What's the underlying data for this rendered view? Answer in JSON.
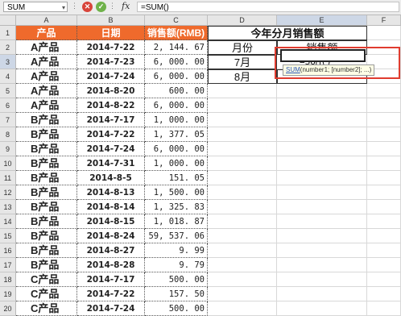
{
  "formula_bar": {
    "name_box": "SUM",
    "formula": "=SUM()",
    "fx_label": "fx"
  },
  "columns": [
    "A",
    "B",
    "C",
    "D",
    "E",
    "F"
  ],
  "rows": [
    "1",
    "2",
    "3",
    "4",
    "5",
    "6",
    "7",
    "8",
    "9",
    "10",
    "11",
    "12",
    "13",
    "14",
    "15",
    "16",
    "17",
    "18",
    "19",
    "20"
  ],
  "table": {
    "headers": [
      "产品",
      "日期",
      "销售额(RMB)"
    ],
    "rows": [
      [
        "A产品",
        "2014-7-22",
        "2, 144. 67"
      ],
      [
        "A产品",
        "2014-7-23",
        "6, 000. 00"
      ],
      [
        "A产品",
        "2014-7-24",
        "6, 000. 00"
      ],
      [
        "A产品",
        "2014-8-20",
        "600. 00"
      ],
      [
        "A产品",
        "2014-8-22",
        "6, 000. 00"
      ],
      [
        "B产品",
        "2014-7-17",
        "1, 000. 00"
      ],
      [
        "B产品",
        "2014-7-22",
        "1, 377. 05"
      ],
      [
        "B产品",
        "2014-7-24",
        "6, 000. 00"
      ],
      [
        "B产品",
        "2014-7-31",
        "1, 000. 00"
      ],
      [
        "B产品",
        "2014-8-5",
        "151. 05"
      ],
      [
        "B产品",
        "2014-8-13",
        "1, 500. 00"
      ],
      [
        "B产品",
        "2014-8-14",
        "1, 325. 83"
      ],
      [
        "B产品",
        "2014-8-15",
        "1, 018. 87"
      ],
      [
        "B产品",
        "2014-8-24",
        "59, 537. 06"
      ],
      [
        "B产品",
        "2014-8-27",
        "9. 99"
      ],
      [
        "B产品",
        "2014-8-28",
        "9. 79"
      ],
      [
        "C产品",
        "2014-7-17",
        "500. 00"
      ],
      [
        "C产品",
        "2014-7-22",
        "157. 50"
      ],
      [
        "C产品",
        "2014-7-24",
        "500. 00"
      ]
    ]
  },
  "summary": {
    "title": "今年分月销售额",
    "month_header": "月份",
    "sales_header": "销售额",
    "months": [
      "7月",
      "8月"
    ],
    "active_formula": "=SUM()",
    "tooltip_fn": "SUM",
    "tooltip_args": "(number1; [number2]; ...)"
  },
  "colors": {
    "header_bg": "#ef6a2c",
    "highlight_border": "#e03c2f"
  }
}
